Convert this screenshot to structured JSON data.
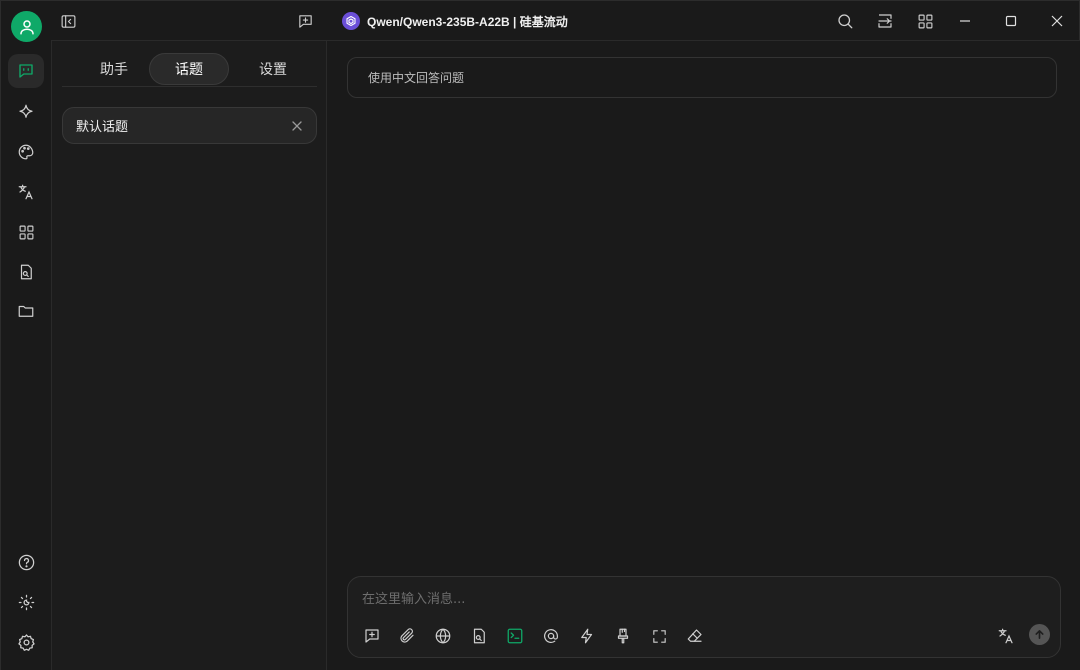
{
  "titlebar": {
    "model_name": "Qwen/Qwen3-235B-A22B | 硅基流动"
  },
  "rail": {
    "items": [
      "chat-icon",
      "sparkle-icon",
      "palette-icon",
      "translate-icon",
      "apps-icon",
      "file-search-icon",
      "folder-icon"
    ],
    "bottom": [
      "help-icon",
      "theme-icon",
      "settings-icon"
    ]
  },
  "sidebar": {
    "tabs": [
      {
        "label": "助手"
      },
      {
        "label": "话题",
        "active": true
      },
      {
        "label": "设置"
      }
    ],
    "topics": [
      {
        "label": "默认话题"
      }
    ]
  },
  "main": {
    "system_prompt": "使用中文回答问题",
    "composer": {
      "placeholder": "在这里输入消息..."
    }
  },
  "colors": {
    "accent": "#0fa968",
    "background": "#1a1a1a",
    "model_logo": "#6b4fd8"
  }
}
